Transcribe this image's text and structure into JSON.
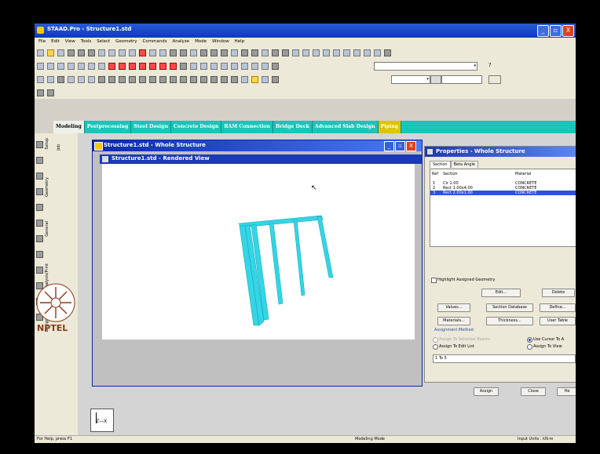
{
  "app": {
    "title": "STAAD.Pro - Structure1.std",
    "window_buttons": [
      "_",
      "▫",
      "X"
    ]
  },
  "menu": [
    "File",
    "Edit",
    "View",
    "Tools",
    "Select",
    "Geometry",
    "Commands",
    "Analyze",
    "Mode",
    "Window",
    "Help"
  ],
  "page_control_tabs": [
    "Modeling",
    "Postprocessing",
    "Steel Design",
    "Concrete Design",
    "RAM Connection",
    "Bridge Deck",
    "Advanced Slab Design",
    "Piping"
  ],
  "sidebar": {
    "pages": [
      "Setup",
      "Geometry",
      "General",
      "Analysis/Print",
      "Design"
    ],
    "subpages": [
      "Job"
    ]
  },
  "workspace_window": {
    "title": "Structure1.std - Whole Structure",
    "buttons": [
      "_",
      "▫",
      "X"
    ]
  },
  "rendered_view": {
    "title": "Structure1.std - Rendered View",
    "model_color": "#33d6e6"
  },
  "properties": {
    "title": "Properties - Whole Structure",
    "tabs": [
      "Section",
      "Beta Angle"
    ],
    "headers": {
      "ref": "Ref",
      "section": "Section",
      "material": "Material"
    },
    "rows": [
      {
        "ref": "1",
        "section": "Cir 1.00",
        "material": "CONCRETE"
      },
      {
        "ref": "2",
        "section": "Rect 1.00x4.00",
        "material": "CONCRETE"
      },
      {
        "ref": "3",
        "section": "Rect 2.00x1.00",
        "material": "CONCRETE"
      }
    ],
    "highlight_label": "Highlight Assigned Geometry",
    "buttons": {
      "edit": "Edit...",
      "delete": "Delete",
      "values": "Values...",
      "section_database": "Section Database",
      "define": "Define...",
      "materials": "Materials...",
      "thickness": "Thickness...",
      "user_table": "User Table"
    },
    "assignment_method": "Assignment Method",
    "options": {
      "assign_to_selected": "Assign To Selected Beams",
      "use_cursor": "Use Cursor To A",
      "assign_to_edit_list": "Assign To Edit List",
      "assign_to_view": "Assign To View"
    },
    "edit_list_value": "1 To 5",
    "bottom_buttons": {
      "assign": "Assign",
      "close": "Close",
      "help": "He"
    }
  },
  "axes_label": "Z—X",
  "logo_text": "NPTEL",
  "status": {
    "left": "For Help, press F1",
    "mode": "Modeling Mode",
    "units": "Input Units : kN-m"
  },
  "colors": {
    "title_bar": "#0a3bb8",
    "tab_strip": "#1cc4b8",
    "selection": "#2b54d8"
  }
}
